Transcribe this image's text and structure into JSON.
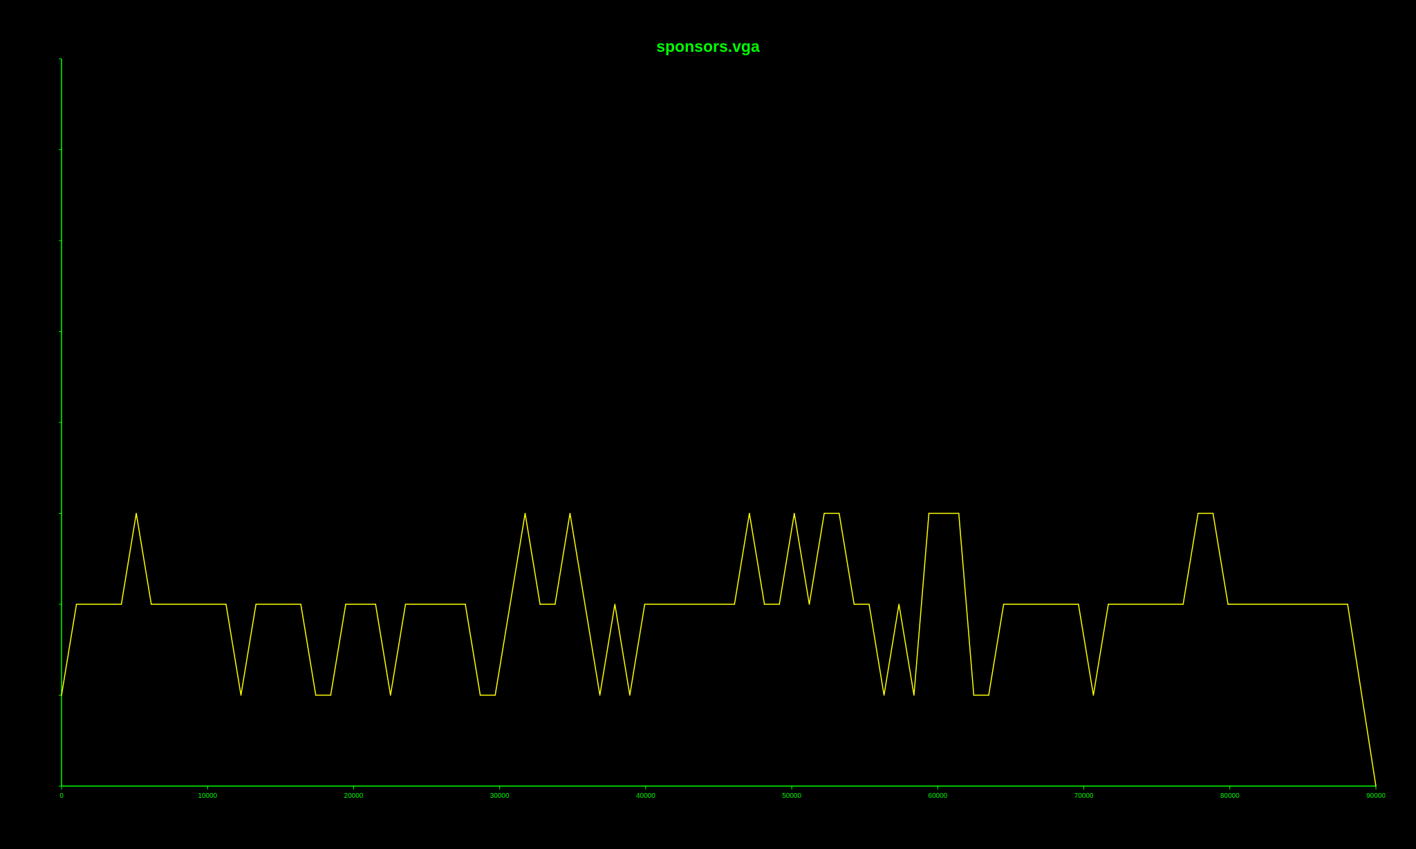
{
  "chart_data": {
    "type": "line",
    "title": "sponsors.vga",
    "xlabel": "",
    "ylabel": "",
    "xlim": [
      0,
      90000
    ],
    "ylim": [
      0,
      8
    ],
    "x_ticks": [
      0,
      10000,
      20000,
      30000,
      40000,
      50000,
      60000,
      70000,
      80000,
      90000
    ],
    "x_tick_labels": [
      "0",
      "10000",
      "20000",
      "30000",
      "40000",
      "50000",
      "60000",
      "70000",
      "80000",
      "90000"
    ],
    "y_ticks": [
      0,
      1,
      2,
      3,
      4,
      5,
      6,
      7,
      8
    ],
    "y_tick_labels": [],
    "grid": false,
    "colors": {
      "background": "#000000",
      "axis": "#00ff00",
      "title": "#00ff00",
      "tick_label": "#00ff00",
      "series": "#ffff00"
    },
    "series": [
      {
        "x": [
          0,
          1024,
          4096,
          5120,
          6144,
          11264,
          12288,
          13312,
          16384,
          17408,
          18432,
          19456,
          21504,
          22528,
          23552,
          27648,
          28672,
          29696,
          31744,
          32768,
          33792,
          34816,
          36864,
          37888,
          38912,
          39936,
          46080,
          47104,
          48128,
          49152,
          50176,
          51200,
          52224,
          53248,
          54272,
          55296,
          56320,
          57344,
          58368,
          59392,
          61440,
          62464,
          63488,
          64512,
          69632,
          70656,
          71680,
          76800,
          77824,
          78848,
          79872,
          88064,
          90000
        ],
        "values": [
          1,
          2,
          2,
          3,
          2,
          2,
          1,
          2,
          2,
          1,
          1,
          2,
          2,
          1,
          2,
          2,
          1,
          1,
          3,
          2,
          2,
          3,
          1,
          2,
          1,
          2,
          2,
          3,
          2,
          2,
          3,
          2,
          3,
          3,
          2,
          2,
          1,
          2,
          1,
          3,
          3,
          1,
          1,
          2,
          2,
          1,
          2,
          2,
          3,
          3,
          2,
          2,
          0
        ]
      }
    ]
  }
}
